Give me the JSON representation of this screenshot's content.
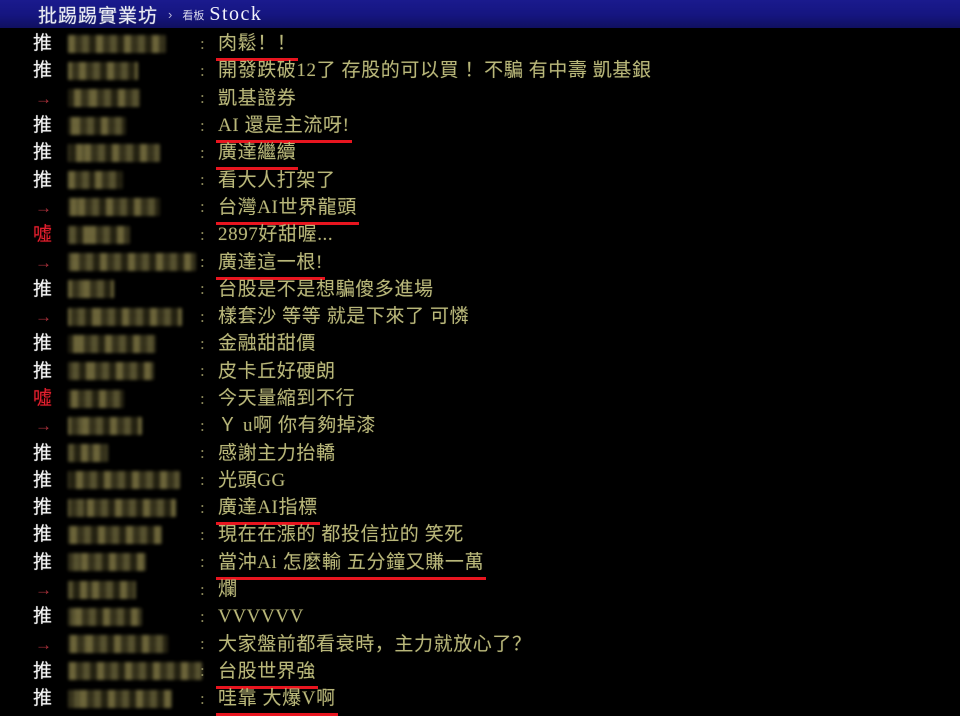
{
  "header": {
    "site_title": "批踢踢實業坊",
    "separator": "›",
    "board_label": "看板",
    "board_name": "Stock",
    "bg_color": "#15157f",
    "text_color": "#e9e9f5"
  },
  "colors": {
    "page_background": "#000000",
    "comment_text": "#b9b77a",
    "push_tag": "#f4f4f4",
    "boo_tag": "#e02030",
    "arrow_tag": "#a8303a",
    "underline": "#e8151f",
    "redaction": "#3e3a22"
  },
  "list": {
    "colon": ":",
    "tags": {
      "push": "推",
      "boo": "噓",
      "arrow": "→"
    },
    "rows": [
      {
        "tag": "推",
        "tag_type": "push",
        "text": "肉鬆！！",
        "underlined": true,
        "author_width": 98
      },
      {
        "tag": "推",
        "tag_type": "push",
        "text": "開發跌破12了  存股的可以買  ！不騙   有中壽  凱基銀",
        "underlined": false,
        "author_width": 70
      },
      {
        "tag": "→",
        "tag_type": "arrow",
        "text": "凱基證券",
        "underlined": false,
        "author_width": 72
      },
      {
        "tag": "推",
        "tag_type": "push",
        "text": "AI  還是主流呀!",
        "underlined": true,
        "author_width": 58
      },
      {
        "tag": "推",
        "tag_type": "push",
        "text": "廣達繼續",
        "underlined": true,
        "author_width": 92
      },
      {
        "tag": "推",
        "tag_type": "push",
        "text": "看大人打架了",
        "underlined": false,
        "author_width": 55
      },
      {
        "tag": "→",
        "tag_type": "arrow",
        "text": "台灣AI世界龍頭",
        "underlined": true,
        "author_width": 92
      },
      {
        "tag": "噓",
        "tag_type": "boo",
        "text": "2897好甜喔...",
        "underlined": false,
        "author_width": 62
      },
      {
        "tag": "→",
        "tag_type": "arrow",
        "text": "廣達這一根!",
        "underlined": true,
        "author_width": 128
      },
      {
        "tag": "推",
        "tag_type": "push",
        "text": "台股是不是想騙傻多進場",
        "underlined": false,
        "author_width": 46
      },
      {
        "tag": "→",
        "tag_type": "arrow",
        "text": "樣套沙  等等  就是下來了  可憐",
        "underlined": false,
        "author_width": 114
      },
      {
        "tag": "推",
        "tag_type": "push",
        "text": "金融甜甜價",
        "underlined": false,
        "author_width": 88
      },
      {
        "tag": "推",
        "tag_type": "push",
        "text": "皮卡丘好硬朗",
        "underlined": false,
        "author_width": 86
      },
      {
        "tag": "噓",
        "tag_type": "boo",
        "text": "今天量縮到不行",
        "underlined": false,
        "author_width": 56
      },
      {
        "tag": "→",
        "tag_type": "arrow",
        "text": "Ｙ u啊  你有夠掉漆",
        "underlined": false,
        "author_width": 74
      },
      {
        "tag": "推",
        "tag_type": "push",
        "text": "感謝主力抬轎",
        "underlined": false,
        "author_width": 40
      },
      {
        "tag": "推",
        "tag_type": "push",
        "text": "光頭GG",
        "underlined": false,
        "author_width": 112
      },
      {
        "tag": "推",
        "tag_type": "push",
        "text": "廣達AI指標",
        "underlined": true,
        "author_width": 108
      },
      {
        "tag": "推",
        "tag_type": "push",
        "text": "現在在漲的  都投信拉的  笑死",
        "underlined": false,
        "author_width": 94
      },
      {
        "tag": "推",
        "tag_type": "push",
        "text": "當沖Ai  怎麼輸  五分鐘又賺一萬",
        "underlined": true,
        "author_width": 78
      },
      {
        "tag": "→",
        "tag_type": "arrow",
        "text": "爛",
        "underlined": false,
        "author_width": 68
      },
      {
        "tag": "推",
        "tag_type": "push",
        "text": "VVVVVV",
        "underlined": false,
        "author_width": 74
      },
      {
        "tag": "→",
        "tag_type": "arrow",
        "text": "大家盤前都看衰時，主力就放心了？",
        "underlined": false,
        "author_width": 100
      },
      {
        "tag": "推",
        "tag_type": "push",
        "text": "台股世界強",
        "underlined": true,
        "author_width": 134
      },
      {
        "tag": "推",
        "tag_type": "push",
        "text": "哇靠  大爆V啊",
        "underlined": true,
        "author_width": 104
      }
    ]
  }
}
